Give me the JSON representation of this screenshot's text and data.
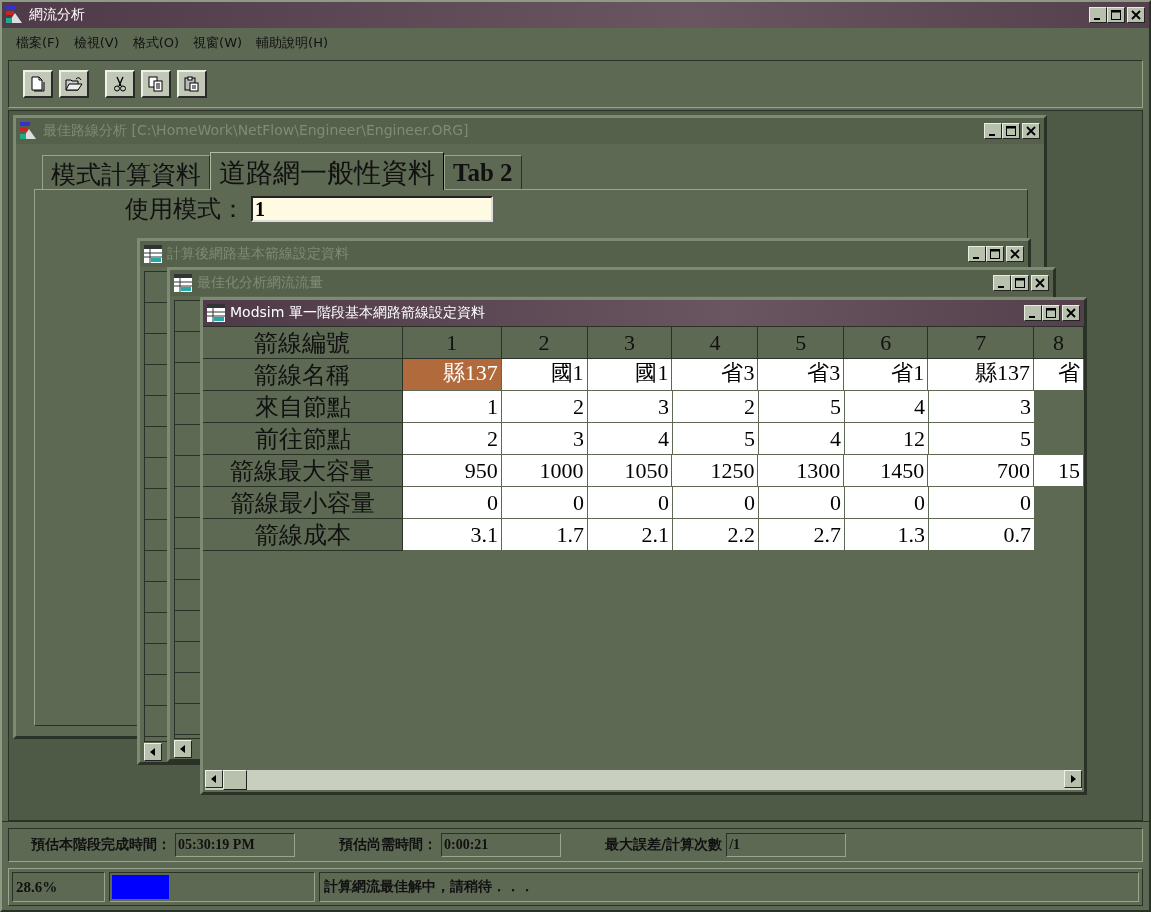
{
  "window": {
    "title": "網流分析",
    "active": true
  },
  "menu": [
    {
      "label": "檔案(F)"
    },
    {
      "label": "檢視(V)"
    },
    {
      "label": "格式(O)"
    },
    {
      "label": "視窗(W)"
    },
    {
      "label": "輔助說明(H)"
    }
  ],
  "toolbar": [
    {
      "kind": "new"
    },
    {
      "kind": "open"
    },
    {
      "kind": "cut"
    },
    {
      "kind": "copy"
    },
    {
      "kind": "paste"
    }
  ],
  "route_window": {
    "title": "最佳路線分析 [C:\\HomeWork\\NetFlow\\Engineer\\Engineer.ORG]",
    "active": false,
    "tabs": [
      {
        "label": "模式計算資料",
        "selected": false
      },
      {
        "label": "道路網一般性資料",
        "selected": true
      },
      {
        "label": "Tab 2",
        "selected": false
      }
    ],
    "mode_label": "使用模式：",
    "mode_value": "1"
  },
  "computed_window": {
    "title": "計算後網路基本箭線設定資料",
    "active": false
  },
  "optimized_window": {
    "title": "最佳化分析網流流量",
    "active": false
  },
  "table_window": {
    "title": "Modsim 單一階段基本網路箭線設定資料",
    "active": true,
    "header_label": "箭線編號",
    "columns": [
      "1",
      "2",
      "3",
      "4",
      "5",
      "6",
      "7",
      "8"
    ],
    "rows": [
      {
        "label": "箭線名稱",
        "cells": [
          {
            "text": "縣137",
            "selected": true
          },
          {
            "text": "國1",
            "selected": false
          },
          {
            "text": "國1",
            "selected": false
          },
          {
            "text": "省3",
            "selected": false
          },
          {
            "text": "省3",
            "selected": false
          },
          {
            "text": "省1",
            "selected": false
          },
          {
            "text": "縣137",
            "selected": false
          },
          {
            "text": "省",
            "selected": false
          }
        ]
      },
      {
        "label": "來自節點",
        "cells": [
          {
            "text": "1",
            "selected": false
          },
          {
            "text": "2",
            "selected": false
          },
          {
            "text": "3",
            "selected": false
          },
          {
            "text": "2",
            "selected": false
          },
          {
            "text": "5",
            "selected": false
          },
          {
            "text": "4",
            "selected": false
          },
          {
            "text": "3",
            "selected": false
          }
        ]
      },
      {
        "label": "前往節點",
        "cells": [
          {
            "text": "2",
            "selected": false
          },
          {
            "text": "3",
            "selected": false
          },
          {
            "text": "4",
            "selected": false
          },
          {
            "text": "5",
            "selected": false
          },
          {
            "text": "4",
            "selected": false
          },
          {
            "text": "12",
            "selected": false
          },
          {
            "text": "5",
            "selected": false
          }
        ]
      },
      {
        "label": "箭線最大容量",
        "cells": [
          {
            "text": "950",
            "selected": false
          },
          {
            "text": "1000",
            "selected": false
          },
          {
            "text": "1050",
            "selected": false
          },
          {
            "text": "1250",
            "selected": false
          },
          {
            "text": "1300",
            "selected": false
          },
          {
            "text": "1450",
            "selected": false
          },
          {
            "text": "700",
            "selected": false
          },
          {
            "text": "15",
            "selected": false
          }
        ]
      },
      {
        "label": "箭線最小容量",
        "cells": [
          {
            "text": "0",
            "selected": false
          },
          {
            "text": "0",
            "selected": false
          },
          {
            "text": "0",
            "selected": false
          },
          {
            "text": "0",
            "selected": false
          },
          {
            "text": "0",
            "selected": false
          },
          {
            "text": "0",
            "selected": false
          },
          {
            "text": "0",
            "selected": false
          }
        ]
      },
      {
        "label": "箭線成本",
        "cells": [
          {
            "text": "3.1",
            "selected": false
          },
          {
            "text": "1.7",
            "selected": false
          },
          {
            "text": "2.1",
            "selected": false
          },
          {
            "text": "2.2",
            "selected": false
          },
          {
            "text": "2.7",
            "selected": false
          },
          {
            "text": "1.3",
            "selected": false
          },
          {
            "text": "0.7",
            "selected": false
          }
        ]
      }
    ]
  },
  "status": {
    "fields": [
      {
        "label": "預估本階段完成時間：",
        "value": "05:30:19 PM"
      },
      {
        "label": "預估尚需時間：",
        "value": "0:00:21"
      },
      {
        "label": "最大誤差/計算次數",
        "value": "/1"
      }
    ],
    "percent": "28.6%",
    "progress": {
      "level": 0.286
    },
    "message": "計算網流最佳解中，請稍待．．．"
  }
}
